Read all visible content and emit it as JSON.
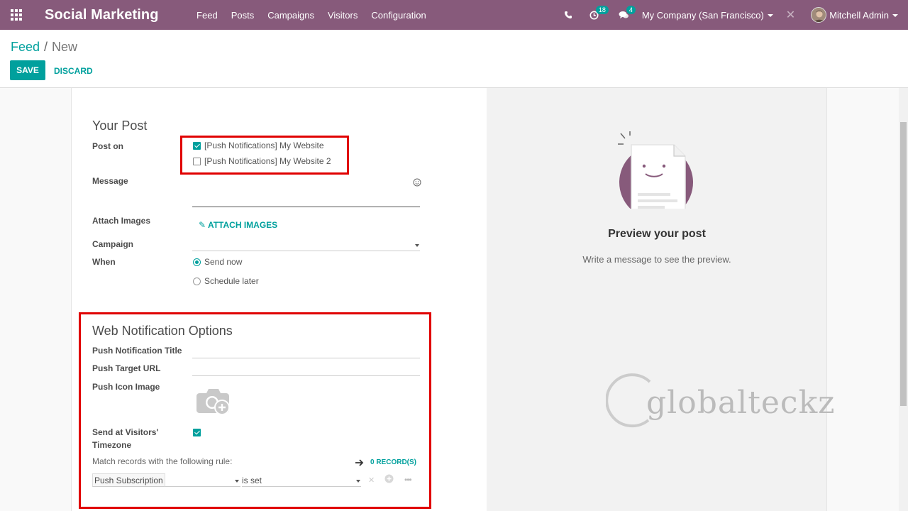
{
  "navbar": {
    "brand": "Social Marketing",
    "menu": [
      "Feed",
      "Posts",
      "Campaigns",
      "Visitors",
      "Configuration"
    ],
    "activities_count": "18",
    "messages_count": "4",
    "company": "My Company (San Francisco)",
    "user": "Mitchell Admin"
  },
  "breadcrumb": {
    "parent": "Feed",
    "separator": "/",
    "current": "New"
  },
  "buttons": {
    "save": "SAVE",
    "discard": "DISCARD"
  },
  "post": {
    "title": "Your Post",
    "post_on_label": "Post on",
    "accounts": [
      {
        "name": "[Push Notifications] My Website",
        "checked": true
      },
      {
        "name": "[Push Notifications] My Website 2",
        "checked": false
      }
    ],
    "message_label": "Message",
    "attach_label": "Attach Images",
    "attach_button": "ATTACH IMAGES",
    "campaign_label": "Campaign",
    "when_label": "When",
    "when_options": [
      {
        "label": "Send now",
        "checked": true
      },
      {
        "label": "Schedule later",
        "checked": false
      }
    ]
  },
  "web_notification": {
    "title": "Web Notification Options",
    "push_title_label": "Push Notification Title",
    "push_url_label": "Push Target URL",
    "push_icon_label": "Push Icon Image",
    "timezone_label_1": "Send at Visitors'",
    "timezone_label_2": "Timezone",
    "timezone_checked": true,
    "match_rule": "Match records with the following rule:",
    "records": "0 RECORD(S)",
    "rule_field": "Push Subscription",
    "rule_operator": "is set"
  },
  "preview": {
    "title": "Preview your post",
    "subtitle": "Write a message to see the preview."
  },
  "watermark": "globalteckz",
  "colors": {
    "navbar": "#875a7b",
    "accent": "#00a09d",
    "highlight": "#e00000"
  }
}
